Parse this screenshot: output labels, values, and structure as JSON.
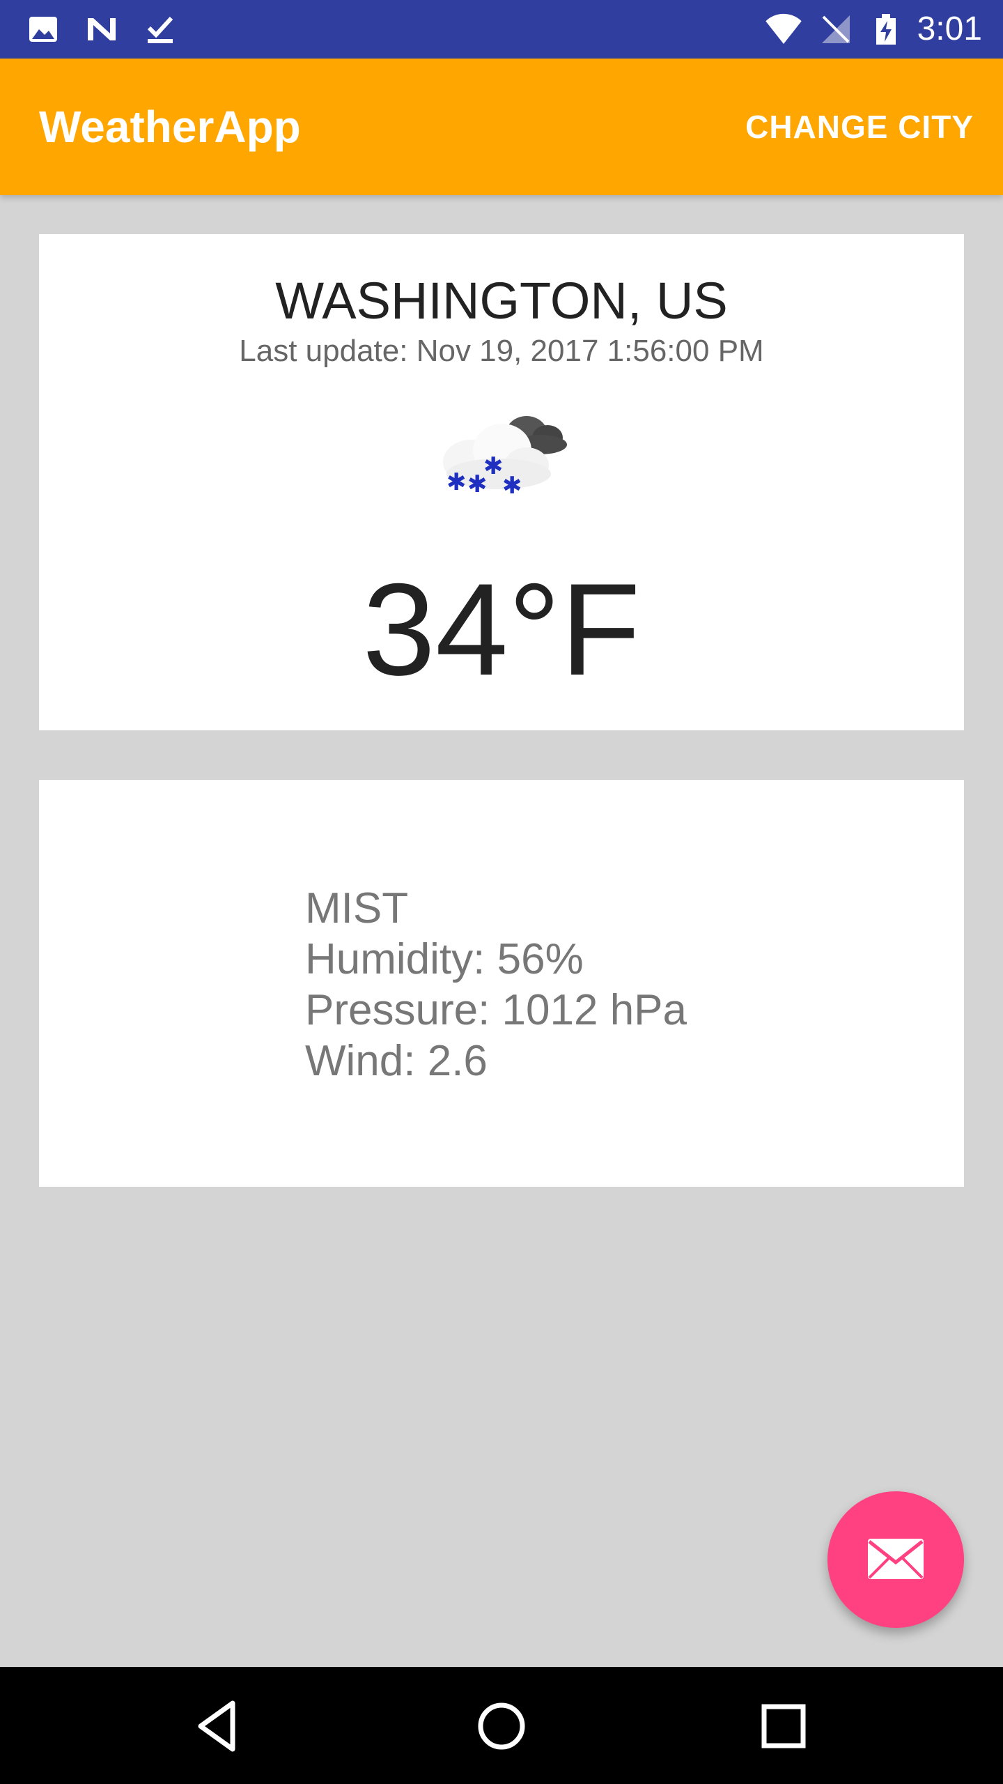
{
  "status_bar": {
    "time": "3:01",
    "background_color": "#303f9f",
    "left_icons": [
      "image-icon",
      "n-logo-icon",
      "download-done-icon"
    ],
    "right_icons": [
      "wifi-icon",
      "no-signal-icon",
      "battery-charging-icon"
    ]
  },
  "app_bar": {
    "title": "WeatherApp",
    "action_label": "CHANGE CITY",
    "background_color": "#ffa600"
  },
  "weather": {
    "city": "WASHINGTON, US",
    "last_update": "Last update: Nov 19, 2017 1:56:00 PM",
    "icon": "snow-cloud-icon",
    "temperature": "34°F"
  },
  "details": {
    "description": "MIST",
    "humidity": "Humidity: 56%",
    "pressure": "Pressure: 1012 hPa",
    "wind": "Wind: 2.6"
  },
  "fab": {
    "icon": "mail-icon",
    "color": "#ff4081"
  },
  "nav_bar": {
    "buttons": [
      "back-icon",
      "home-icon",
      "recents-icon"
    ]
  }
}
